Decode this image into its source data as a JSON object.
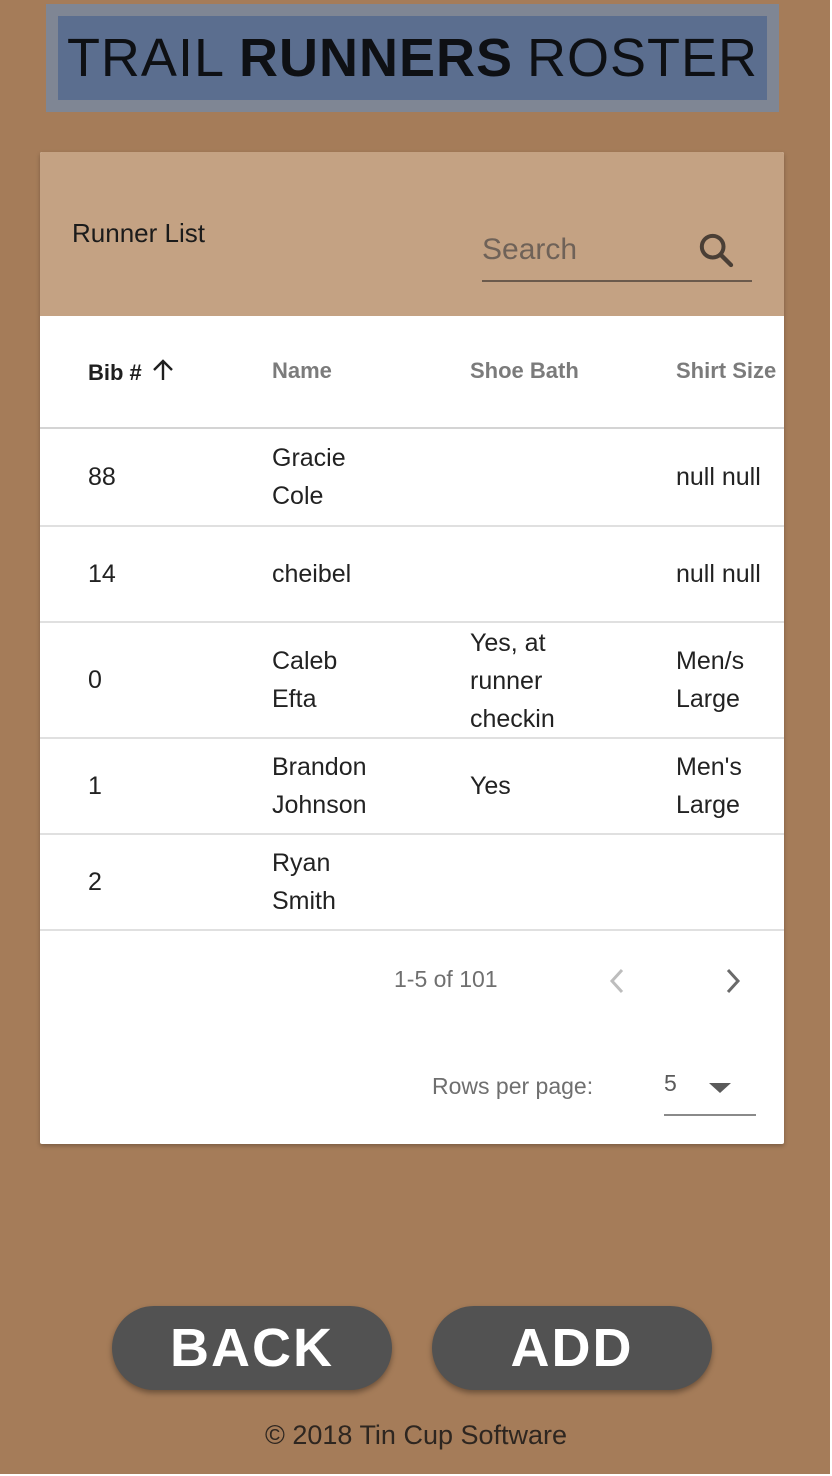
{
  "header": {
    "title_part1": "TRAIL",
    "title_part2": "RUNNERS",
    "title_part3": "ROSTER"
  },
  "card": {
    "title": "Runner List",
    "search": {
      "placeholder": "Search",
      "value": ""
    }
  },
  "table": {
    "columns": [
      {
        "label": "Bib #",
        "sort": "ascending"
      },
      {
        "label": "Name"
      },
      {
        "label": "Shoe Bath"
      },
      {
        "label": "Shirt Size"
      }
    ],
    "rows": [
      {
        "bib": "88",
        "name": [
          "Gracie",
          "Cole"
        ],
        "shoe": [],
        "shirt": [
          "null null"
        ]
      },
      {
        "bib": "14",
        "name": [
          "cheibel"
        ],
        "shoe": [],
        "shirt": [
          "null null"
        ]
      },
      {
        "bib": "0",
        "name": [
          "Caleb",
          "Efta"
        ],
        "shoe": [
          "Yes, at",
          "runner",
          "checkin"
        ],
        "shirt": [
          "Men/s",
          "Large"
        ]
      },
      {
        "bib": "1",
        "name": [
          "Brandon",
          "Johnson"
        ],
        "shoe": [
          "Yes"
        ],
        "shirt": [
          "Men's",
          "Large"
        ]
      },
      {
        "bib": "2",
        "name": [
          "Ryan",
          "Smith"
        ],
        "shoe": [],
        "shirt": []
      }
    ]
  },
  "pagination": {
    "range": "1-5 of 101",
    "rows_per_page_label": "Rows per page:",
    "rows_per_page": "5"
  },
  "actions": {
    "back_label": "BACK",
    "add_label": "ADD"
  },
  "footer": {
    "text": "© 2018 Tin Cup Software"
  },
  "colors": {
    "background": "#a57c59",
    "card_header": "#c4a283",
    "title_box": "#5b6e8f",
    "button": "#525252"
  },
  "icons": {
    "search": "search-icon",
    "sort": "arrow-up-icon",
    "prev": "chevron-left-icon",
    "next": "chevron-right-icon",
    "dropdown": "caret-down-icon"
  }
}
